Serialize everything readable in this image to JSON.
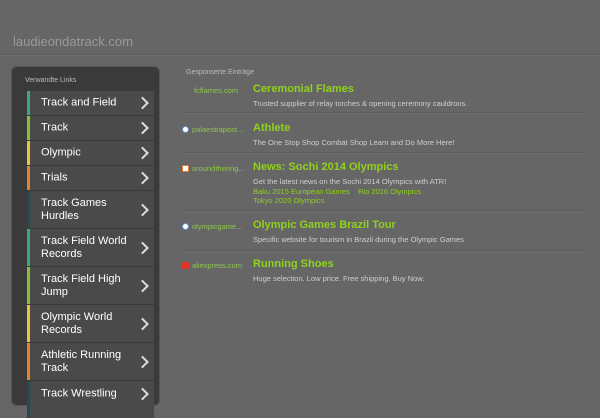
{
  "header": {
    "site_name": "laudieondatrack.com"
  },
  "sidebar": {
    "title": "Verwandte Links",
    "items": [
      {
        "label": "Track and Field",
        "color": "#3aa883"
      },
      {
        "label": "Track",
        "color": "#8bbf3a"
      },
      {
        "label": "Olympic",
        "color": "#e8c540"
      },
      {
        "label": "Trials",
        "color": "#e4822d"
      },
      {
        "label": "Track Games Hurdles",
        "color": "#1f4c56"
      },
      {
        "label": "Track Field World Records",
        "color": "#3aa883"
      },
      {
        "label": "Track Field High Jump",
        "color": "#8bbf3a"
      },
      {
        "label": "Olympic World Records",
        "color": "#e8c540"
      },
      {
        "label": "Athletic Running Track",
        "color": "#e4822d"
      },
      {
        "label": "Track Wrestling",
        "color": "#1f4c56"
      }
    ]
  },
  "main": {
    "title": "Gesponserte Einträge",
    "entries": [
      {
        "source": "fcflames.com",
        "title": "Ceremonial Flames",
        "description": "Trusted supplier of relay torches & opening ceremony cauldrons.",
        "icon": "none-icon",
        "links": []
      },
      {
        "source": "palaestrapost...",
        "title": "Athlete",
        "description": "The One Stop Shop Combat Shop Learn and Do More Here!",
        "icon": "globe-icon",
        "links": []
      },
      {
        "source": "aroundthering...",
        "title": "News: Sochi 2014 Olympics",
        "description": "Get the latest news on the Sochi 2014 Olympics with ATR!",
        "icon": "rss-icon",
        "links": [
          "Baku 2015 European Games",
          "Rio 2016 Olympics",
          "Tokyo 2020 Olympics"
        ]
      },
      {
        "source": "olympicgame...",
        "title": "Olympic Games Brazil Tour",
        "description": "Specific website for tourism in Brazil during the Olympic Games",
        "icon": "globe-icon",
        "links": []
      },
      {
        "source": "aliexpress.com",
        "title": "Running Shoes",
        "description": "Huge selection. Low price. Free shipping. Buy Now.",
        "icon": "aliexpress-icon",
        "links": []
      }
    ]
  }
}
